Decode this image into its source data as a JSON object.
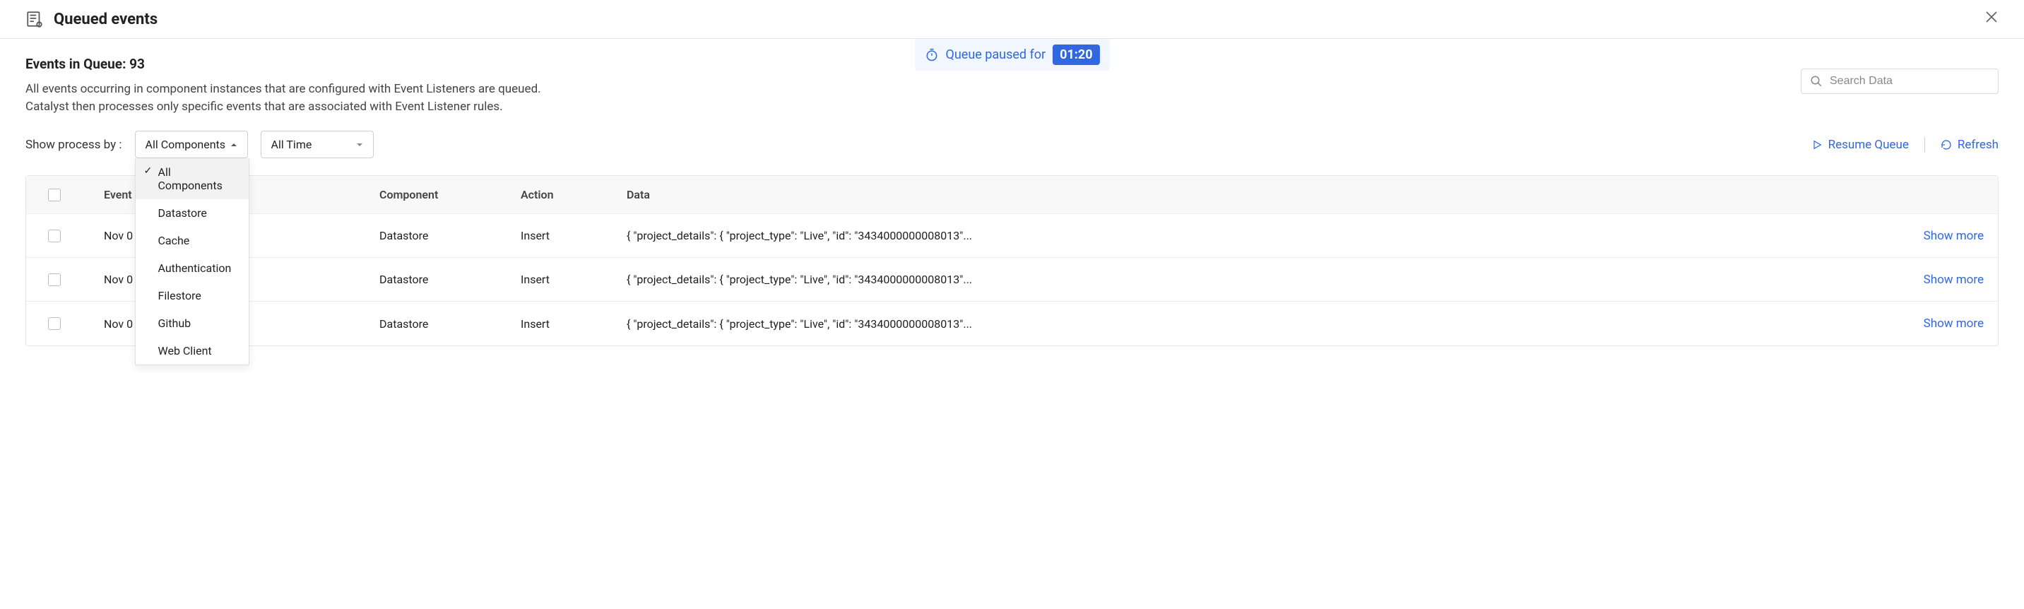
{
  "header": {
    "title": "Queued events"
  },
  "pause_banner": {
    "text": "Queue paused for",
    "timer": "01:20"
  },
  "queue_count_label": "Events in Queue: 93",
  "queue_description": "All events occurring in component instances that are configured with Event Listeners are queued. Catalyst then processes only specific events that are associated with Event Listener rules.",
  "search": {
    "placeholder": "Search Data"
  },
  "filter": {
    "label": "Show process by :",
    "component_selected": "All Components",
    "component_options": [
      "All Components",
      "Datastore",
      "Cache",
      "Authentication",
      "Filestore",
      "Github",
      "Web Client"
    ],
    "time_selected": "All Time"
  },
  "actions": {
    "resume": "Resume Queue",
    "refresh": "Refresh"
  },
  "table": {
    "headers": {
      "time": "Event",
      "component": "Component",
      "action": "Action",
      "data": "Data"
    },
    "show_more_label": "Show more",
    "rows": [
      {
        "time": "Nov 0",
        "component": "Datastore",
        "action": "Insert",
        "data": "{ \"project_details\": { \"project_type\": \"Live\", \"id\": \"3434000000008013\"..."
      },
      {
        "time": "Nov 0",
        "component": "Datastore",
        "action": "Insert",
        "data": "{ \"project_details\": { \"project_type\": \"Live\", \"id\": \"3434000000008013\"..."
      },
      {
        "time": "Nov 0",
        "component": "Datastore",
        "action": "Insert",
        "data": "{ \"project_details\": { \"project_type\": \"Live\", \"id\": \"3434000000008013\"..."
      }
    ]
  }
}
